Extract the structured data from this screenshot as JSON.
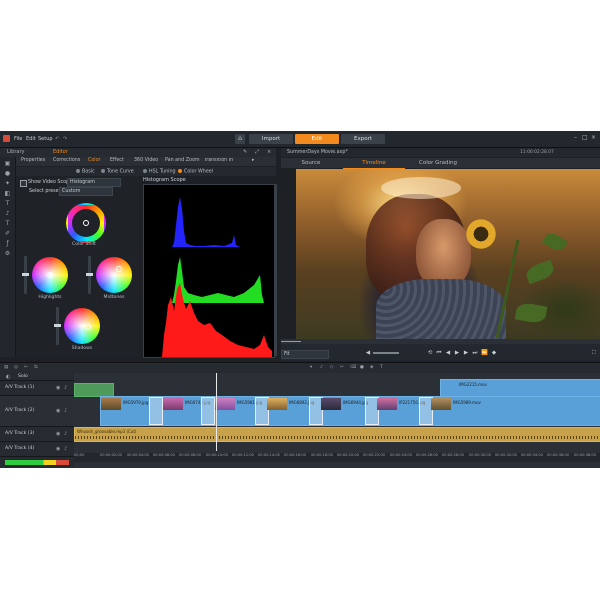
{
  "app": {
    "menu": [
      "File",
      "Edit",
      "Setup"
    ],
    "modes": [
      {
        "label": "Import",
        "active": false
      },
      {
        "label": "Edit",
        "active": true
      },
      {
        "label": "Export",
        "active": false
      }
    ],
    "accent": "#f28a1e"
  },
  "left_panel": {
    "top_tabs": [
      {
        "label": "Library",
        "active": false
      },
      {
        "label": "Editor",
        "active": true
      }
    ],
    "sub_tabs": [
      {
        "label": "Properties",
        "active": false
      },
      {
        "label": "Corrections",
        "active": false
      },
      {
        "label": "Color",
        "active": true
      },
      {
        "label": "Effect",
        "active": false
      },
      {
        "label": "360 Video",
        "active": false
      },
      {
        "label": "Pan and Zoom",
        "active": false
      },
      {
        "label": "Transition In",
        "active": false
      }
    ],
    "radios": [
      {
        "label": "Basic",
        "active": false
      },
      {
        "label": "Tone Curve",
        "active": false
      },
      {
        "label": "HSL Tuning",
        "active": false
      },
      {
        "label": "Color Wheel",
        "active": true
      }
    ],
    "show_scope_label": "Show Video Scope",
    "scope_value": "Histogram",
    "preset_label": "Select preset",
    "preset_value": "Custom",
    "wheels": {
      "shift": "Color Shift",
      "highlights": "Highlights",
      "midtones": "Midtones",
      "shadows": "Shadows"
    },
    "scope_title": "Histogram Scope"
  },
  "preview": {
    "title": "SummerDays Movie.axp*",
    "timecode": "11:00:02:28.07",
    "tabs": [
      {
        "label": "Source",
        "active": false
      },
      {
        "label": "Timeline",
        "active": true
      },
      {
        "label": "Color Grading",
        "active": false
      }
    ],
    "fit_label": "Fit"
  },
  "timeline": {
    "tracks": [
      {
        "name": "Solo"
      },
      {
        "name": "A/V Track (1)"
      },
      {
        "name": "A/V Track (2)"
      },
      {
        "name": "A/V Track (3)"
      },
      {
        "name": "A/V Track (4)"
      }
    ],
    "clips_track2": [
      {
        "label": "IMG5970.jpg"
      },
      {
        "label": "IMG6742.jpg"
      },
      {
        "label": "IMG5981.jpg"
      },
      {
        "label": "IMG6892.jpg"
      },
      {
        "label": "IMG6944.jpg"
      },
      {
        "label": "IP221750.jpg"
      },
      {
        "label": "IMG5989.mov"
      }
    ],
    "clip_track1": "IMG2215.mov",
    "audio_label": "Whoosh_groovable.mp3 (Cut)",
    "ruler": [
      "00:00",
      "00:00:02:00",
      "00:00:04:00",
      "00:00:06:00",
      "00:00:08:00",
      "00:00:10:00",
      "00:00:12:00",
      "00:00:14:00",
      "00:00:16:00",
      "00:00:18:00",
      "00:00:20:00",
      "00:00:22:00",
      "00:00:24:00",
      "00:00:26:00",
      "00:00:28:00",
      "00:00:30:00",
      "00:00:32:00",
      "00:00:34:00",
      "00:00:36:00",
      "00:00:38:00"
    ]
  }
}
